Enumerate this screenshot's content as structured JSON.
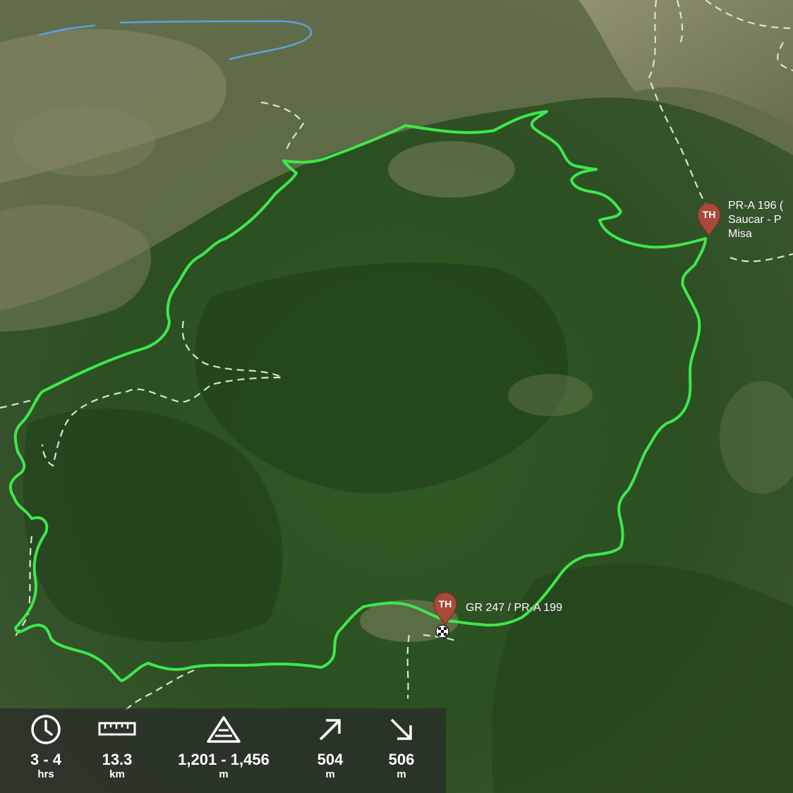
{
  "map": {
    "route_color": "#3de84c",
    "trail_color": "#cfe9d0",
    "river_color": "#5aa0e0",
    "trailheads": [
      {
        "marker_text": "TH",
        "label_lines": [
          "PR-A 196 (",
          "Saucar - P",
          "Misa"
        ]
      },
      {
        "marker_text": "TH",
        "label_lines": [
          "GR 247 / PR-A 199"
        ]
      }
    ]
  },
  "stats": {
    "duration": {
      "icon": "clock-icon",
      "value": "3 - 4",
      "unit": "hrs"
    },
    "distance": {
      "icon": "ruler-icon",
      "value": "13.3",
      "unit": "km"
    },
    "elevation": {
      "icon": "elevation-icon",
      "value": "1,201 - 1,456",
      "unit": "m"
    },
    "ascent": {
      "icon": "arrow-up-right-icon",
      "value": "504",
      "unit": "m"
    },
    "descent": {
      "icon": "arrow-down-right-icon",
      "value": "506",
      "unit": "m"
    }
  }
}
